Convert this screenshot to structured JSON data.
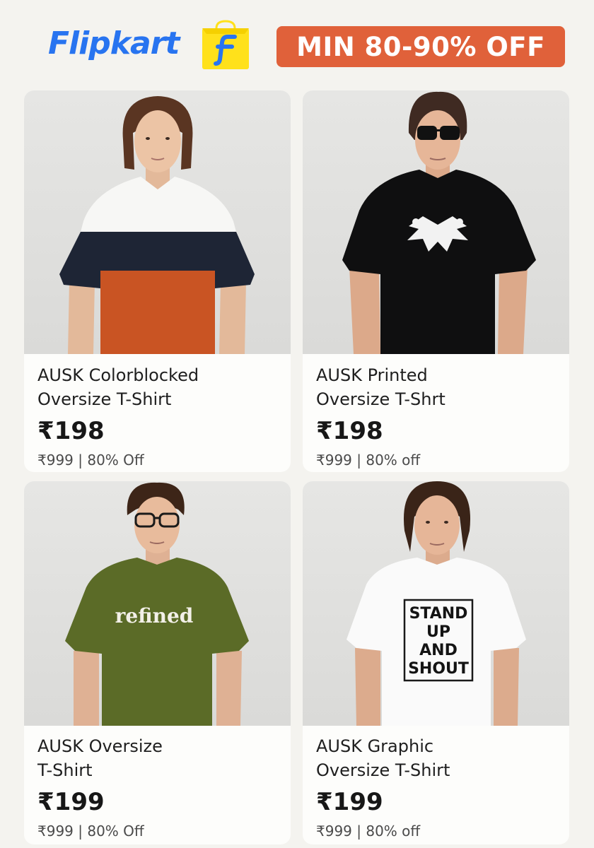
{
  "header": {
    "logo_text": "Flipkart",
    "offer": "MIN 80-90% OFF",
    "brand_color": "#2874f0",
    "logo_yellow": "#ffe11b",
    "offer_color": "#e0613a"
  },
  "products": [
    {
      "title": "AUSK Colorblocked\nOversize T-Shirt",
      "price": "₹198",
      "mrp_line": "₹999 | 80% Off",
      "shirt": "colorblock navy/white/orange"
    },
    {
      "title": "AUSK Printed\nOversize T-Shrt",
      "price": "₹198",
      "mrp_line": "₹999 | 80% off",
      "shirt": "black with white inkblot print"
    },
    {
      "title": "AUSK Oversize\nT-Shirt",
      "price": "₹199",
      "mrp_line": "₹999 | 80% Off",
      "shirt": "olive green",
      "print_text": "refined"
    },
    {
      "title": "AUSK Graphic\nOversize T-Shirt",
      "price": "₹199",
      "mrp_line": "₹999 | 80% off",
      "shirt": "white",
      "print_lines": [
        "STAND",
        "UP",
        "AND",
        "SHOUT"
      ]
    }
  ]
}
